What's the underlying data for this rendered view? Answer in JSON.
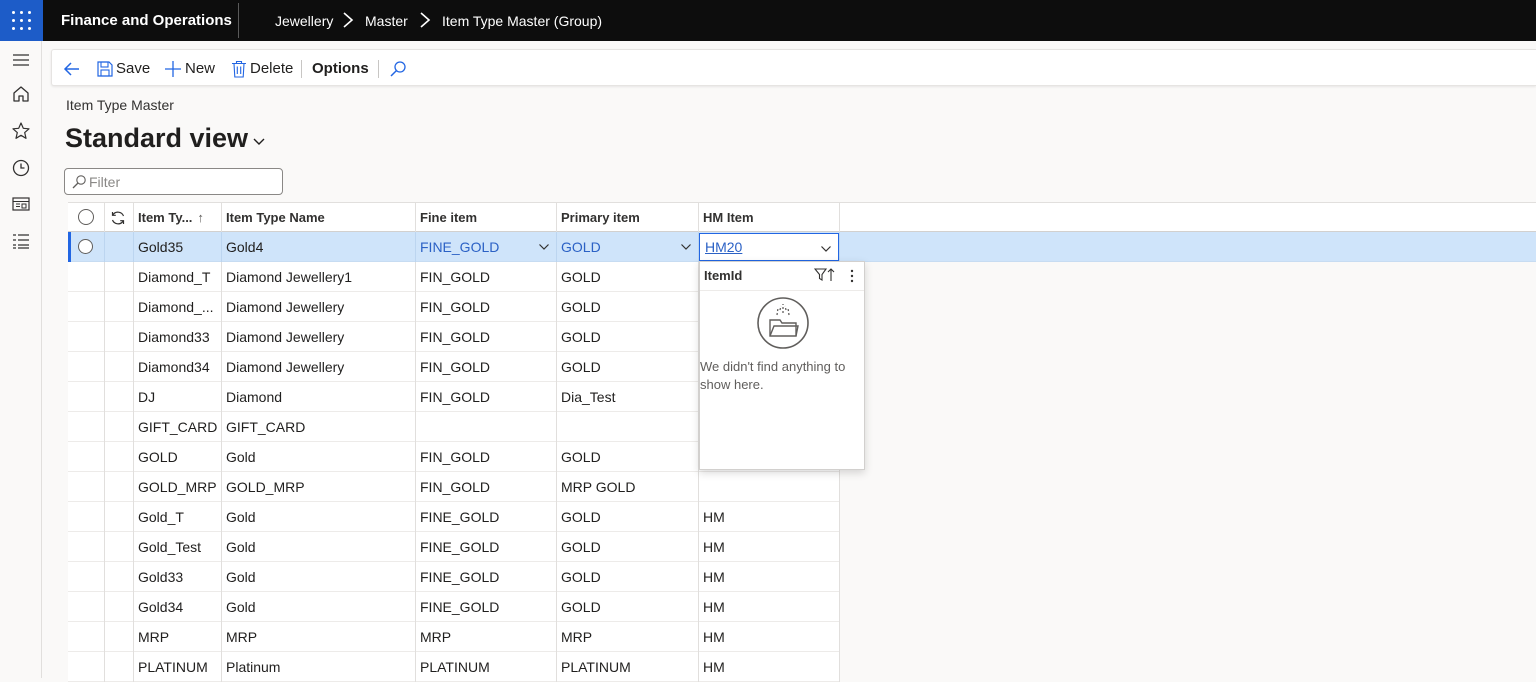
{
  "topbar": {
    "app_title": "Finance and Operations",
    "breadcrumbs": [
      "Jewellery",
      "Master",
      "Item Type Master (Group)"
    ]
  },
  "actions": {
    "back_icon": "back-arrow-icon",
    "save": "Save",
    "new": "New",
    "delete": "Delete",
    "options": "Options",
    "search_icon": "search-icon"
  },
  "page": {
    "caption": "Item Type Master",
    "view_name": "Standard view",
    "filter_placeholder": "Filter"
  },
  "grid": {
    "columns": [
      "Item Ty...",
      "Item Type Name",
      "Fine item",
      "Primary item",
      "HM Item"
    ],
    "sort_indicator": "↑",
    "rows": [
      {
        "item_type": "Gold35",
        "name": "Gold4",
        "fine": "FINE_GOLD",
        "primary": "GOLD",
        "hm": "HM20",
        "selected": true
      },
      {
        "item_type": "Diamond_T",
        "name": "Diamond Jewellery1",
        "fine": "FIN_GOLD",
        "primary": "GOLD",
        "hm": ""
      },
      {
        "item_type": "Diamond_...",
        "name": "Diamond Jewellery",
        "fine": "FIN_GOLD",
        "primary": "GOLD",
        "hm": ""
      },
      {
        "item_type": "Diamond33",
        "name": "Diamond Jewellery",
        "fine": "FIN_GOLD",
        "primary": "GOLD",
        "hm": ""
      },
      {
        "item_type": "Diamond34",
        "name": "Diamond Jewellery",
        "fine": "FIN_GOLD",
        "primary": "GOLD",
        "hm": ""
      },
      {
        "item_type": "DJ",
        "name": "Diamond",
        "fine": "FIN_GOLD",
        "primary": "Dia_Test",
        "hm": ""
      },
      {
        "item_type": "GIFT_CARD",
        "name": "GIFT_CARD",
        "fine": "",
        "primary": "",
        "hm": ""
      },
      {
        "item_type": "GOLD",
        "name": "Gold",
        "fine": "FIN_GOLD",
        "primary": "GOLD",
        "hm": ""
      },
      {
        "item_type": "GOLD_MRP",
        "name": "GOLD_MRP",
        "fine": "FIN_GOLD",
        "primary": "MRP GOLD",
        "hm": ""
      },
      {
        "item_type": "Gold_T",
        "name": "Gold",
        "fine": "FINE_GOLD",
        "primary": "GOLD",
        "hm": "HM"
      },
      {
        "item_type": "Gold_Test",
        "name": "Gold",
        "fine": "FINE_GOLD",
        "primary": "GOLD",
        "hm": "HM"
      },
      {
        "item_type": "Gold33",
        "name": "Gold",
        "fine": "FINE_GOLD",
        "primary": "GOLD",
        "hm": "HM"
      },
      {
        "item_type": "Gold34",
        "name": "Gold",
        "fine": "FINE_GOLD",
        "primary": "GOLD",
        "hm": "HM"
      },
      {
        "item_type": "MRP",
        "name": "MRP",
        "fine": "MRP",
        "primary": "MRP",
        "hm": "HM"
      },
      {
        "item_type": "PLATINUM",
        "name": "Platinum",
        "fine": "PLATINUM",
        "primary": "PLATINUM",
        "hm": "HM"
      }
    ]
  },
  "lookup": {
    "header": "ItemId",
    "empty_message": "We didn't find anything to show here."
  },
  "colors": {
    "topbar": "#0d0d0d",
    "waffle": "#1d5cc8",
    "selected_row": "#cfe4fa",
    "accent": "#2266e3",
    "link": "#2b61c5"
  }
}
